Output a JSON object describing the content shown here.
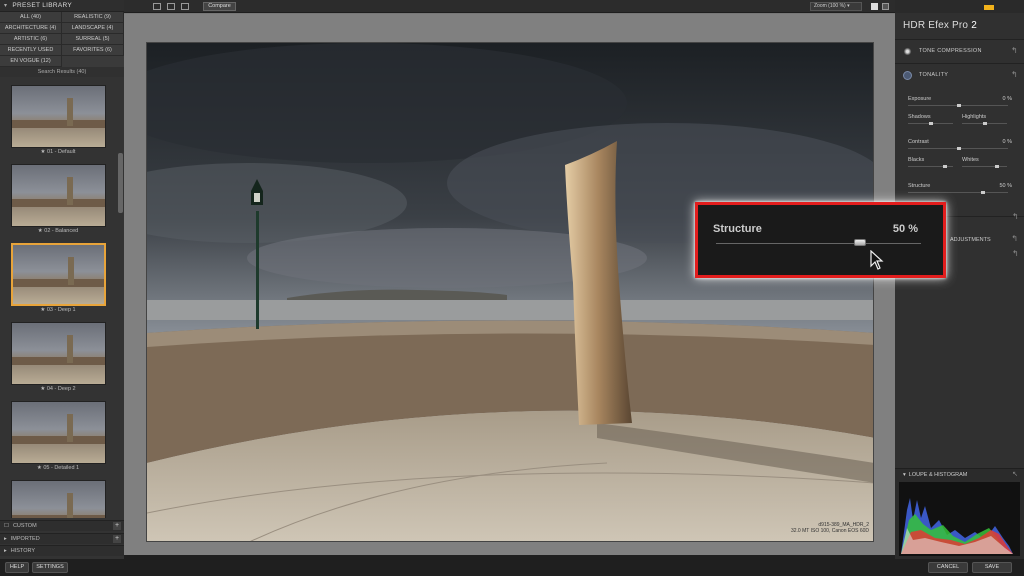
{
  "left_panel": {
    "title": "PRESET LIBRARY",
    "categories": [
      {
        "label": "ALL (40)"
      },
      {
        "label": "REALISTIC (9)"
      },
      {
        "label": "ARCHITECTURE (4)"
      },
      {
        "label": "LANDSCAPE (4)"
      },
      {
        "label": "ARTISTIC (6)"
      },
      {
        "label": "SURREAL (5)"
      },
      {
        "label": "RECENTLY USED"
      },
      {
        "label": "FAVORITES (6)"
      },
      {
        "label": "EN VOGUE (12)"
      }
    ],
    "search_results": "Search Results (40)",
    "presets": [
      {
        "label": "★ 01 - Default",
        "selected": false
      },
      {
        "label": "★ 02 - Balanced",
        "selected": false
      },
      {
        "label": "★ 03 - Deep 1",
        "selected": true
      },
      {
        "label": "★ 04 - Deep 2",
        "selected": false
      },
      {
        "label": "★ 05 - Detailed 1",
        "selected": false
      },
      {
        "label": "",
        "selected": false
      }
    ],
    "folds": {
      "custom": "CUSTOM",
      "imported": "IMPORTED",
      "history": "HISTORY"
    },
    "buttons": {
      "help": "HELP",
      "settings": "SETTINGS"
    }
  },
  "toolbar": {
    "compare": "Compare",
    "zoom": "Zoom (100 %)"
  },
  "image_info": {
    "line1": "d915-389_MA_HDR_2",
    "line2": "32.0 MT ISO 100, Canon EOS 60D"
  },
  "right_panel": {
    "app_name": "HDR Efex Pro",
    "app_version": "2",
    "sections": {
      "tone_compression": "TONE COMPRESSION",
      "tonality": "TONALITY",
      "adjustments": "ADJUSTMENTS",
      "loupe": "LOUPE & HISTOGRAM"
    },
    "controls": {
      "exposure": {
        "label": "Exposure",
        "value": "0 %"
      },
      "shadows": {
        "label": "Shadows"
      },
      "highlights": {
        "label": "Highlights"
      },
      "contrast": {
        "label": "Contrast",
        "value": "0 %"
      },
      "blacks": {
        "label": "Blacks"
      },
      "whites": {
        "label": "Whites"
      },
      "structure": {
        "label": "Structure",
        "value": "50 %"
      }
    },
    "buttons": {
      "cancel": "CANCEL",
      "save": "SAVE"
    }
  },
  "callout": {
    "label": "Structure",
    "value": "50 %",
    "slider_fraction": 0.7
  },
  "colors": {
    "accent": "#e8a43a",
    "callout_border": "#e31d1d",
    "brand": "#f2b21b"
  }
}
